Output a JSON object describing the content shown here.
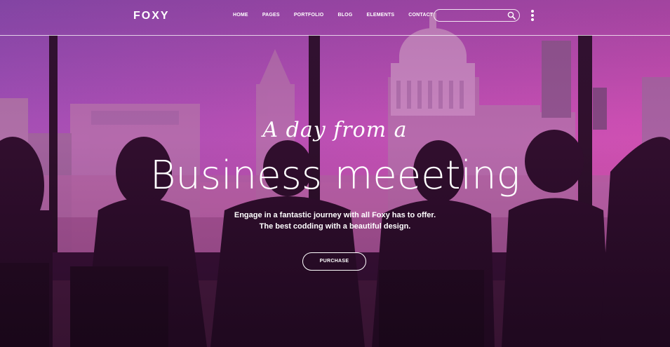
{
  "brand": {
    "logo": "FOXY"
  },
  "nav": {
    "items": [
      "HOME",
      "PAGES",
      "PORTFOLIO",
      "BLOG",
      "ELEMENTS",
      "CONTACT"
    ]
  },
  "search": {
    "value": "",
    "placeholder": ""
  },
  "hero": {
    "script_line": "A day from a",
    "title": "Business meeeting",
    "subtitle_line1": "Engage in a fantastic journey with all Foxy has to offer.",
    "subtitle_line2": "The best codding with a beautiful design.",
    "button_label": "PURCHASE"
  },
  "colors": {
    "sky_top": "#6a3c9a",
    "sky_pink": "#e04fb7",
    "dark_foreground": "#1f0a1f",
    "header_overlay": "#5a2a5a"
  },
  "icons": {
    "search": "search-icon",
    "menu": "kebab-menu-icon"
  }
}
